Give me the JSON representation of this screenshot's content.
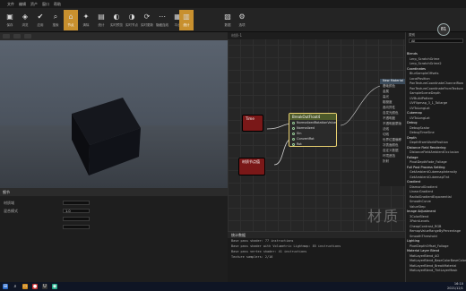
{
  "menubar": {
    "items": [
      "文件",
      "编辑",
      "资产",
      "窗口",
      "帮助"
    ]
  },
  "toolbar": {
    "buttons": [
      {
        "label": "保存",
        "icon": "save-icon",
        "glyph": "▣"
      },
      {
        "label": "浏览",
        "icon": "browse-icon",
        "glyph": "◈"
      },
      {
        "label": "应用",
        "icon": "apply-icon",
        "glyph": "✔"
      },
      {
        "label": "搜索",
        "icon": "search-icon",
        "glyph": "⌕"
      },
      {
        "label": "节点",
        "icon": "home-icon",
        "glyph": "⌂"
      },
      {
        "label": "清除",
        "icon": "clean-icon",
        "glyph": "✦"
      },
      {
        "label": "统计",
        "icon": "stats-icon",
        "glyph": "▤"
      },
      {
        "label": "实时预览",
        "icon": "preview-icon",
        "glyph": "◐"
      },
      {
        "label": "实时节点",
        "icon": "nodes-icon",
        "glyph": "◑"
      },
      {
        "label": "实时更新",
        "icon": "update-icon",
        "glyph": "⟳"
      },
      {
        "label": "隐藏连线",
        "icon": "hide-icon",
        "glyph": "⋯"
      },
      {
        "label": "平台",
        "icon": "platform-icon",
        "glyph": "▦"
      },
      {
        "label": "统计",
        "icon": "stats2-icon",
        "glyph": "▥"
      },
      {
        "label": "数据",
        "icon": "data-icon",
        "glyph": "▧"
      },
      {
        "label": "选项",
        "icon": "options-icon",
        "glyph": "⚙"
      }
    ]
  },
  "details": {
    "header": "细节",
    "rows": [
      {
        "label": "材质域",
        "value": ""
      },
      {
        "label": "混合模式",
        "value": "1.0"
      },
      {
        "label": "",
        "value": ""
      },
      {
        "label": "",
        "value": ""
      }
    ]
  },
  "graph": {
    "tab": "材质-1",
    "nodes": {
      "time": {
        "title": "Time"
      },
      "constant": {
        "title": "材质节点值"
      },
      "main": {
        "title": "BreakOutFloat4",
        "pins": [
          "NormalizedRotationValue",
          "Normalized",
          "Sin",
          "ConvertRot",
          "Rot"
        ]
      }
    },
    "side_pins": [
      "基础颜色",
      "金属",
      "高光",
      "粗糙度",
      "各向异性",
      "自发光颜色",
      "不透明度",
      "不透明度蒙版",
      "法线",
      "切线",
      "世界位置偏移",
      "次表面颜色",
      "自定义数据",
      "环境遮挡",
      "折射"
    ],
    "result_label": "New Material"
  },
  "stats": {
    "header": "统计数据",
    "lines": [
      "Base pass shader: 77 instructions",
      "Base pass shader with Volumetric Lightmap: 85 instructions",
      "Base pass vertex shader: 41 instructions",
      "Texture samplers: 2/16"
    ]
  },
  "palette": {
    "category_label": "类别",
    "filter": "All",
    "rows": [
      {
        "t": "Blends",
        "cat": true
      },
      {
        "t": "Lerp_ScratchGrime"
      },
      {
        "t": "Lerp_ScratchGrime2"
      },
      {
        "t": "Coordinates",
        "cat": true
      },
      {
        "t": "BlurSampleOffsets"
      },
      {
        "t": "LocalPosition"
      },
      {
        "t": "PanTextureCoordinateChannelRow"
      },
      {
        "t": "PanTextureCoordinateFromTexture"
      },
      {
        "t": "SampleSceneDepth"
      },
      {
        "t": "UVBuildPattern"
      },
      {
        "t": "UVFlipmap_3_1_Tollarge"
      },
      {
        "t": "UVToLongLat"
      },
      {
        "t": "Cubemap",
        "cat": true
      },
      {
        "t": "UVToLongLat"
      },
      {
        "t": "Debug",
        "cat": true
      },
      {
        "t": "DebugScalar"
      },
      {
        "t": "DebugTimeSine"
      },
      {
        "t": "Depth",
        "cat": true
      },
      {
        "t": "DepthFromWorldPosition"
      },
      {
        "t": "Distance Field Rendering",
        "cat": true
      },
      {
        "t": "DistanceFieldAmbientOcclusion"
      },
      {
        "t": "Foliage",
        "cat": true
      },
      {
        "t": "PivotDepthFade_Foliage"
      },
      {
        "t": "Full Post Process Setting",
        "cat": true
      },
      {
        "t": "GetAmbientCubemapIntensity"
      },
      {
        "t": "GetAmbientCubemapTint"
      },
      {
        "t": "Gradient",
        "cat": true
      },
      {
        "t": "DiamondGradient"
      },
      {
        "t": "LinearGradient"
      },
      {
        "t": "RadialGradientExponential"
      },
      {
        "t": "SmoothCurve"
      },
      {
        "t": "ValueStep"
      },
      {
        "t": "Image Adjustment",
        "cat": true
      },
      {
        "t": "3ColorBlend"
      },
      {
        "t": "3PointLevels"
      },
      {
        "t": "CheapContrast_RGB"
      },
      {
        "t": "RemapValueRangeByPercentage"
      },
      {
        "t": "SmoothThreshold"
      },
      {
        "t": "Lighting",
        "cat": true
      },
      {
        "t": "PixelDepthOffset_Foliage"
      },
      {
        "t": "Material Layer Blend",
        "cat": true
      },
      {
        "t": "MatLayerBlend_AO"
      },
      {
        "t": "MatLayerBlend_BaseColorBaseColor"
      },
      {
        "t": "MatLayerBlend_BreakMaterial"
      },
      {
        "t": "MatLayerBlend_TintLayerMask"
      }
    ]
  },
  "fps": {
    "value": "81"
  },
  "watermark": "材质",
  "taskbar": {
    "time": "16:10",
    "date": "2021/12/1"
  },
  "colors": {
    "accent": "#c8902e",
    "node_time": "#8b1a1a",
    "node_main_border": "#e8d070"
  }
}
